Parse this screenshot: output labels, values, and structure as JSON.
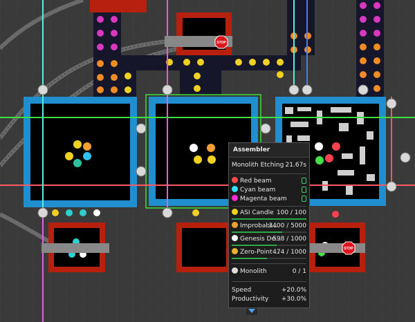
{
  "scene": {
    "stop_sign_label": "STOP",
    "colors": {
      "background": "#3a3a3a",
      "machine_frame": "#1f8fd0",
      "belt": "#16162a",
      "depot": "#b5200f",
      "beam_green": "#3de03d",
      "beam_red": "#ff5a64",
      "beam_cyan": "#53f0e6",
      "beam_magenta": "#e85be8",
      "beam_blue": "#4a7cff"
    }
  },
  "tooltip": {
    "title": "Assembler",
    "recipe": {
      "name": "Monolith Etching",
      "time": "21.67s"
    },
    "beams": [
      {
        "label": "Red beam",
        "color": "#ff4b4b"
      },
      {
        "label": "Cyan beam",
        "color": "#30e0ff"
      },
      {
        "label": "Magenta beam",
        "color": "#ff2bd5"
      }
    ],
    "inputs": [
      {
        "name": "ASI Candle",
        "amount": "100 / 100",
        "color": "#f0d020",
        "progress": 1.0
      },
      {
        "name": "Improbabi...",
        "amount": "3400 / 5000",
        "color": "#f0a030",
        "progress": 0.68
      },
      {
        "name": "Genesis De...",
        "amount": "598 / 1000",
        "color": "#ffffff",
        "progress": 0.598
      },
      {
        "name": "Zero-Point ...",
        "amount": "474 / 1000",
        "color": "#f0b030",
        "progress": 0.474
      }
    ],
    "output": {
      "name": "Monolith",
      "amount": "0 / 1"
    },
    "speed": {
      "label": "Speed",
      "value": "+20.0%"
    },
    "productivity": {
      "label": "Productivity",
      "value": "+30.0%"
    }
  }
}
